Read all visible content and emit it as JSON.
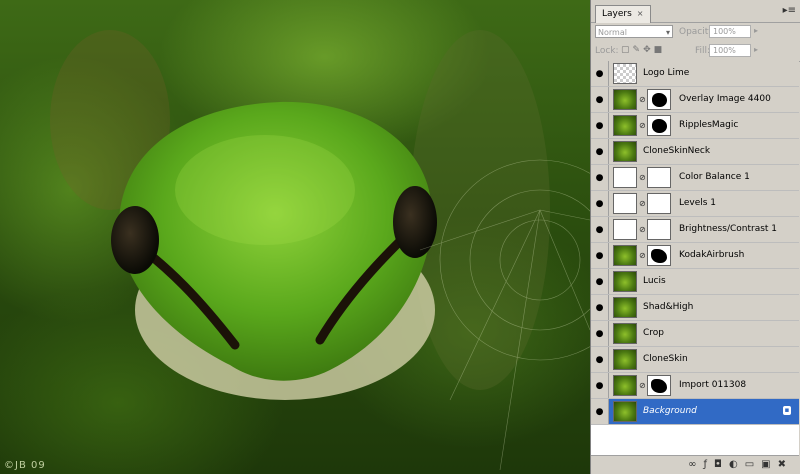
{
  "watermark": "©JB 09",
  "panel": {
    "tab_label": "Layers",
    "tab_close": "×",
    "menu_icon": "▸≡",
    "blend_mode": "Normal",
    "opacity_label": "Opacity:",
    "opacity_value": "100%",
    "lock_label": "Lock:",
    "fill_label": "Fill:",
    "fill_value": "100%"
  },
  "layers": [
    {
      "name": "Logo Lime",
      "thumb": "checker",
      "mask": null
    },
    {
      "name": "Overlay Image 4400",
      "thumb": "frog",
      "mask": "blob"
    },
    {
      "name": "RipplesMagic",
      "thumb": "frog",
      "mask": "blob"
    },
    {
      "name": "CloneSkinNeck",
      "thumb": "frog",
      "mask": null
    },
    {
      "name": "Color Balance 1",
      "thumb": "adjustment",
      "mask": "white"
    },
    {
      "name": "Levels 1",
      "thumb": "adjustment",
      "mask": "white"
    },
    {
      "name": "Brightness/Contrast 1",
      "thumb": "adjustment",
      "mask": "white"
    },
    {
      "name": "KodakAirbrush",
      "thumb": "frog",
      "mask": "blob2"
    },
    {
      "name": "Lucis",
      "thumb": "frog",
      "mask": null
    },
    {
      "name": "Shad&High",
      "thumb": "frog",
      "mask": null
    },
    {
      "name": "Crop",
      "thumb": "frog",
      "mask": null
    },
    {
      "name": "CloneSkin",
      "thumb": "frog",
      "mask": null
    },
    {
      "name": "Import 011308",
      "thumb": "frog",
      "mask": "blob2"
    },
    {
      "name": "Background",
      "thumb": "frog",
      "mask": null,
      "selected": true,
      "locked": true
    }
  ],
  "icons": {
    "eye": "eye-icon",
    "link": "link-icon",
    "lock": "lock-icon"
  },
  "colors": {
    "selection": "#316ac5",
    "panel_bg": "#d4d0c8",
    "frog_green": "#5aa81c"
  }
}
